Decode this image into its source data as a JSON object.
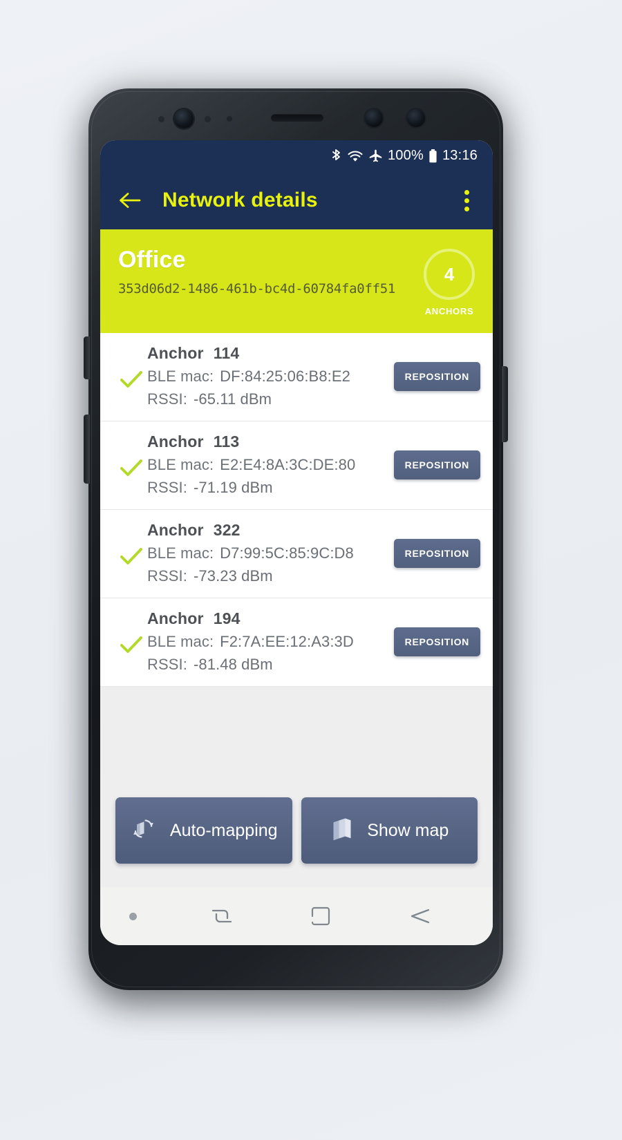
{
  "status_bar": {
    "bluetooth_icon": "bluetooth-icon",
    "wifi_icon": "wifi-icon",
    "airplane_icon": "airplane-mode-icon",
    "battery_percent": "100%",
    "battery_icon": "battery-full-icon",
    "time": "13:16"
  },
  "app_bar": {
    "back_icon": "back-arrow-icon",
    "title": "Network details",
    "overflow_icon": "overflow-menu-icon"
  },
  "network": {
    "name": "Office",
    "uuid": "353d06d2-1486-461b-bc4d-60784fa0ff51",
    "anchor_count": "4",
    "anchor_label": "ANCHORS"
  },
  "labels": {
    "anchor_prefix": "Anchor",
    "ble_mac_label": "BLE mac:",
    "rssi_label": "RSSI:",
    "reposition": "REPOSITION",
    "check_icon": "check-icon"
  },
  "anchors": [
    {
      "name": "Anchor",
      "id": "114",
      "mac_label": "BLE mac:",
      "mac": "DF:84:25:06:B8:E2",
      "rssi_label": "RSSI:",
      "rssi": "-65.11 dBm",
      "button": "REPOSITION",
      "checked": true
    },
    {
      "name": "Anchor",
      "id": "113",
      "mac_label": "BLE mac:",
      "mac": "E2:E4:8A:3C:DE:80",
      "rssi_label": "RSSI:",
      "rssi": "-71.19 dBm",
      "button": "REPOSITION",
      "checked": true
    },
    {
      "name": "Anchor",
      "id": "322",
      "mac_label": "BLE mac:",
      "mac": "D7:99:5C:85:9C:D8",
      "rssi_label": "RSSI:",
      "rssi": "-73.23 dBm",
      "button": "REPOSITION",
      "checked": true
    },
    {
      "name": "Anchor",
      "id": "194",
      "mac_label": "BLE mac:",
      "mac": "F2:7A:EE:12:A3:3D",
      "rssi_label": "RSSI:",
      "rssi": "-81.48 dBm",
      "button": "REPOSITION",
      "checked": true
    }
  ],
  "actions": {
    "auto_mapping": {
      "label": "Auto-mapping",
      "icon": "auto-map-refresh-icon"
    },
    "show_map": {
      "label": "Show map",
      "icon": "map-icon"
    }
  },
  "nav_bar": {
    "indicator_icon": "nav-dot-icon",
    "recents_icon": "recents-icon",
    "home_icon": "home-icon",
    "back_icon": "nav-back-icon"
  },
  "colors": {
    "app_bar": "#1c3055",
    "accent_yellow": "#d6e619",
    "title_yellow": "#e9f20d",
    "button_slate": "#5a6886",
    "check_green": "#b3d92a",
    "page_bg": "#eeeeee"
  }
}
